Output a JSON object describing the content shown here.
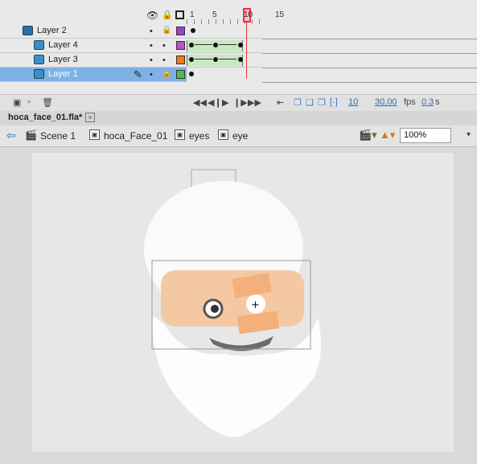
{
  "timeline": {
    "header_icons": [
      "eye-icon",
      "lock-icon",
      "outline-icon"
    ],
    "frame_numbers": [
      "1",
      "5",
      "10",
      "15"
    ],
    "current_frame_label": "10",
    "layers": [
      {
        "name": "Layer 2",
        "color": "#9b3fd1",
        "selected": false,
        "indent": 0
      },
      {
        "name": "Layer 4",
        "color": "#c44bd6",
        "selected": false,
        "indent": 1
      },
      {
        "name": "Layer 3",
        "color": "#f07a1a",
        "selected": false,
        "indent": 1
      },
      {
        "name": "Layer 1",
        "color": "#44c244",
        "selected": true,
        "indent": 1
      }
    ],
    "frame_rate": "10",
    "fps_value": "30.00",
    "fps_unit": "fps",
    "elapsed": "0.3",
    "elapsed_unit": "s"
  },
  "document": {
    "tab_label": "hoca_face_01.fla*",
    "close_glyph": "×"
  },
  "breadcrumb": {
    "items": [
      "Scene 1",
      "hoca_Face_01",
      "eyes",
      "eye"
    ]
  },
  "zoom": {
    "value": "100%"
  },
  "stage": {
    "crosshair": "+"
  }
}
